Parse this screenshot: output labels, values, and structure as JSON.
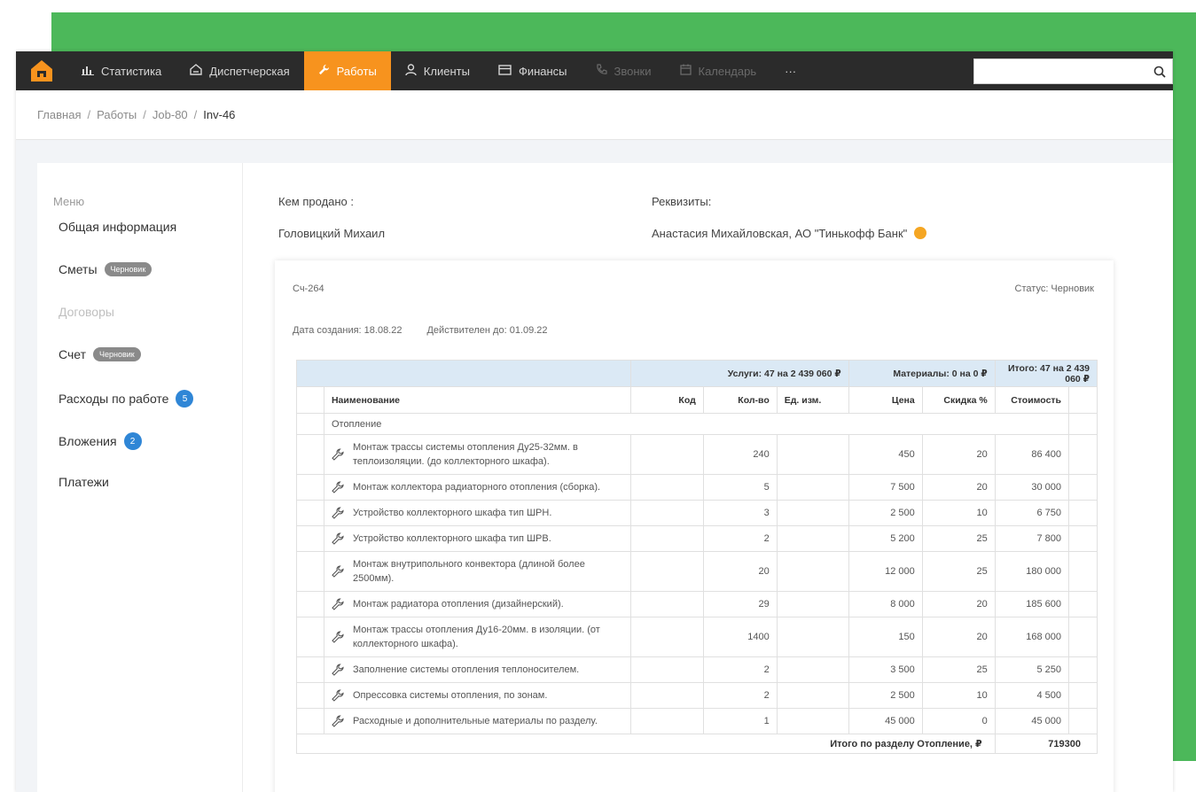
{
  "nav": {
    "items": [
      {
        "label": "Статистика",
        "icon": "bar-chart-icon",
        "state": "normal"
      },
      {
        "label": "Диспетчерская",
        "icon": "dispatch-icon",
        "state": "normal"
      },
      {
        "label": "Работы",
        "icon": "wrench-icon",
        "state": "active"
      },
      {
        "label": "Клиенты",
        "icon": "user-icon",
        "state": "normal"
      },
      {
        "label": "Финансы",
        "icon": "wallet-icon",
        "state": "normal"
      },
      {
        "label": "Звонки",
        "icon": "phone-icon",
        "state": "disabled"
      },
      {
        "label": "Календарь",
        "icon": "calendar-icon",
        "state": "disabled"
      },
      {
        "label": "···",
        "icon": "",
        "state": "normal"
      }
    ],
    "search_value": "",
    "accent_color": "#f7931e"
  },
  "breadcrumb": [
    "Главная",
    "Работы",
    "Job-80",
    "Inv-46"
  ],
  "sidebar": {
    "title": "Меню",
    "items": [
      {
        "label": "Общая информация",
        "badge": "",
        "state": "normal"
      },
      {
        "label": "Сметы",
        "badge": "Черновик",
        "state": "normal"
      },
      {
        "label": "Договоры",
        "badge": "",
        "state": "disabled"
      },
      {
        "label": "Счет",
        "badge": "Черновик",
        "state": "normal"
      },
      {
        "label": "Расходы по работе",
        "count": "5",
        "state": "normal"
      },
      {
        "label": "Вложения",
        "count": "2",
        "state": "normal"
      },
      {
        "label": "Платежи",
        "badge": "",
        "state": "normal"
      }
    ]
  },
  "info": {
    "sold_by_label": "Кем продано :",
    "sold_by_value": "Головицкий Михаил",
    "requisites_label": "Реквизиты:",
    "requisites_value": "Анастасия Михайловская, АО \"Тинькофф Банк\""
  },
  "invoice": {
    "number": "Сч-264",
    "status": "Статус: Черновик",
    "created": "Дата создания: 18.08.22",
    "valid_until": "Действителен до: 01.09.22",
    "summary": {
      "services": "Услуги: 47 на 2 439 060 ₽",
      "materials": "Материалы: 0 на 0 ₽",
      "total": "Итого: 47 на 2 439 060 ₽"
    },
    "columns": {
      "name": "Наименование",
      "code": "Код",
      "qty": "Кол-во",
      "unit": "Ед. изм.",
      "price": "Цена",
      "discount": "Скидка %",
      "cost": "Стоимость"
    },
    "section": "Отопление",
    "rows": [
      {
        "name": "Монтаж трассы системы отопления Ду25-32мм. в теплоизоляции. (до коллекторного шкафа).",
        "code": "",
        "qty": "240",
        "unit": "",
        "price": "450",
        "discount": "20",
        "cost": "86 400"
      },
      {
        "name": "Монтаж коллектора радиаторного отопления (сборка).",
        "code": "",
        "qty": "5",
        "unit": "",
        "price": "7 500",
        "discount": "20",
        "cost": "30 000"
      },
      {
        "name": "Устройство коллекторного шкафа тип ШРН.",
        "code": "",
        "qty": "3",
        "unit": "",
        "price": "2 500",
        "discount": "10",
        "cost": "6 750"
      },
      {
        "name": "Устройство коллекторного шкафа тип ШРВ.",
        "code": "",
        "qty": "2",
        "unit": "",
        "price": "5 200",
        "discount": "25",
        "cost": "7 800"
      },
      {
        "name": "Монтаж внутрипольного конвектора (длиной более 2500мм).",
        "code": "",
        "qty": "20",
        "unit": "",
        "price": "12 000",
        "discount": "25",
        "cost": "180 000"
      },
      {
        "name": "Монтаж радиатора отопления (дизайнерский).",
        "code": "",
        "qty": "29",
        "unit": "",
        "price": "8 000",
        "discount": "20",
        "cost": "185 600"
      },
      {
        "name": "Монтаж трассы отопления Ду16-20мм. в изоляции. (от коллекторного шкафа).",
        "code": "",
        "qty": "1400",
        "unit": "",
        "price": "150",
        "discount": "20",
        "cost": "168 000"
      },
      {
        "name": "Заполнение системы отопления теплоносителем.",
        "code": "",
        "qty": "2",
        "unit": "",
        "price": "3 500",
        "discount": "25",
        "cost": "5 250"
      },
      {
        "name": "Опрессовка системы отопления, по зонам.",
        "code": "",
        "qty": "2",
        "unit": "",
        "price": "2 500",
        "discount": "10",
        "cost": "4 500"
      },
      {
        "name": "Расходные и дополнительные материалы по разделу.",
        "code": "",
        "qty": "1",
        "unit": "",
        "price": "45 000",
        "discount": "0",
        "cost": "45 000"
      }
    ],
    "section_total_label": "Итого по разделу Отопление, ₽",
    "section_total_value": "719300"
  }
}
